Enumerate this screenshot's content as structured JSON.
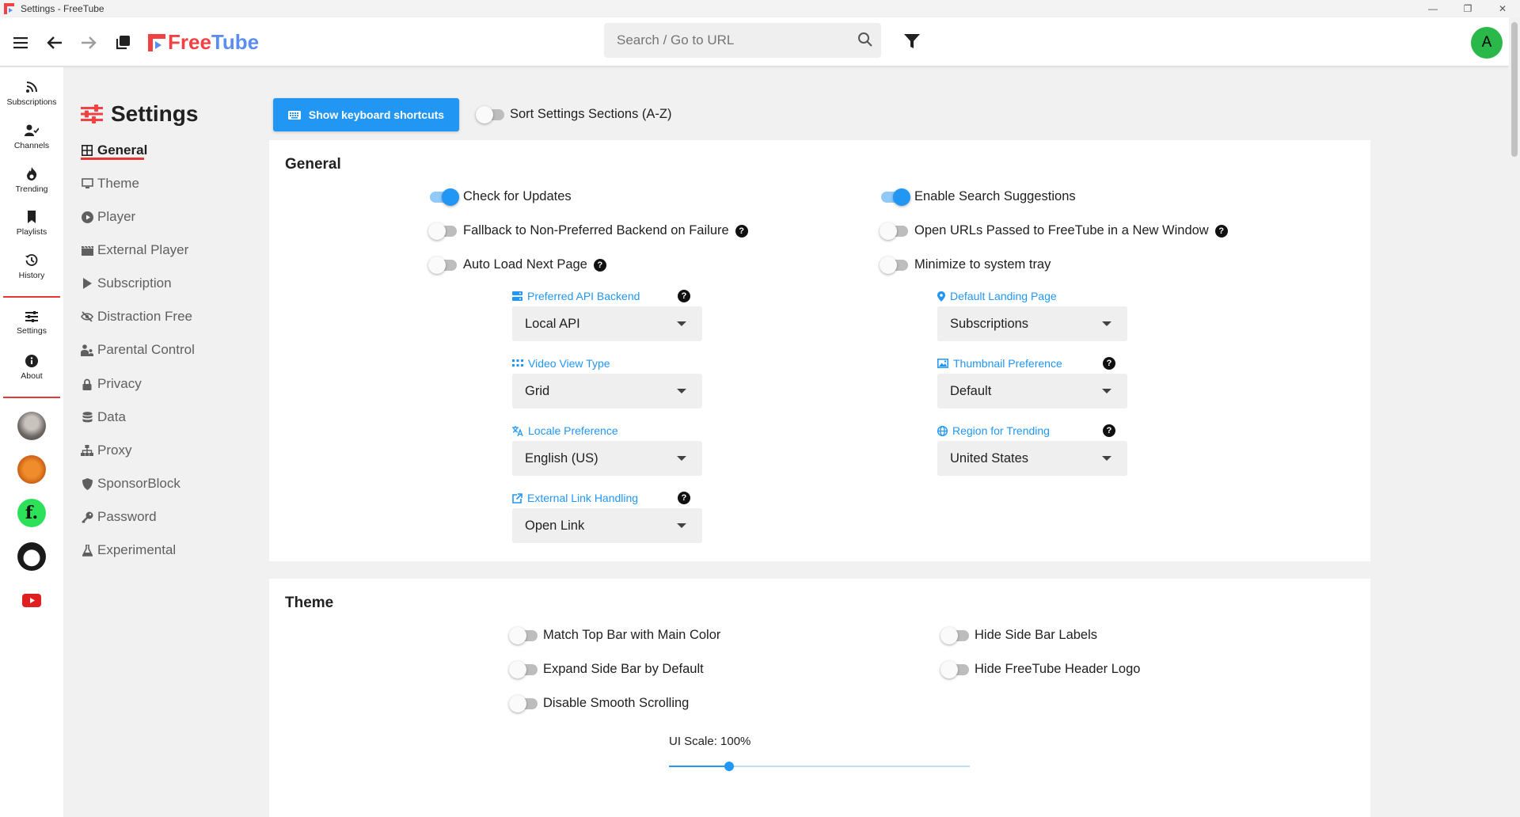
{
  "window": {
    "title": "Settings - FreeTube",
    "controls": [
      "minimize-icon",
      "restore-icon",
      "close-icon"
    ]
  },
  "topnav": {
    "logo_free": "Free",
    "logo_tube": "Tube",
    "search_placeholder": "Search / Go to URL",
    "avatar_letter": "A"
  },
  "sidebar": {
    "items": [
      {
        "label": "Subscriptions",
        "icon": "rss-icon"
      },
      {
        "label": "Channels",
        "icon": "user-check-icon"
      },
      {
        "label": "Trending",
        "icon": "fire-icon"
      },
      {
        "label": "Playlists",
        "icon": "bookmark-icon"
      },
      {
        "label": "History",
        "icon": "history-icon"
      },
      {
        "label": "Settings",
        "icon": "sliders-icon"
      },
      {
        "label": "About",
        "icon": "info-icon"
      }
    ]
  },
  "settings": {
    "title": "Settings",
    "menu": [
      {
        "label": "General",
        "icon": "grid-icon"
      },
      {
        "label": "Theme",
        "icon": "monitor-icon"
      },
      {
        "label": "Player",
        "icon": "play-circle-icon"
      },
      {
        "label": "External Player",
        "icon": "clapperboard-icon"
      },
      {
        "label": "Subscription",
        "icon": "play-icon"
      },
      {
        "label": "Distraction Free",
        "icon": "eye-slash-icon"
      },
      {
        "label": "Parental Control",
        "icon": "parent-child-icon"
      },
      {
        "label": "Privacy",
        "icon": "lock-icon"
      },
      {
        "label": "Data",
        "icon": "database-icon"
      },
      {
        "label": "Proxy",
        "icon": "network-icon"
      },
      {
        "label": "SponsorBlock",
        "icon": "shield-icon"
      },
      {
        "label": "Password",
        "icon": "key-icon"
      },
      {
        "label": "Experimental",
        "icon": "flask-icon"
      }
    ],
    "active_section": "General",
    "keyboard_button": "Show keyboard shortcuts",
    "sort_toggle": {
      "label": "Sort Settings Sections (A-Z)",
      "on": false
    }
  },
  "general": {
    "title": "General",
    "left_toggles": [
      {
        "label": "Check for Updates",
        "on": true,
        "help": false
      },
      {
        "label": "Fallback to Non-Preferred Backend on Failure",
        "on": false,
        "help": true
      },
      {
        "label": "Auto Load Next Page",
        "on": false,
        "help": true
      }
    ],
    "right_toggles": [
      {
        "label": "Enable Search Suggestions",
        "on": true,
        "help": false
      },
      {
        "label": "Open URLs Passed to FreeTube in a New Window",
        "on": false,
        "help": true
      },
      {
        "label": "Minimize to system tray",
        "on": false,
        "help": false
      }
    ],
    "left_selects": [
      {
        "label": "Preferred API Backend",
        "value": "Local API",
        "icon": "server-icon",
        "help": true
      },
      {
        "label": "Video View Type",
        "value": "Grid",
        "icon": "grid-dots-icon",
        "help": false
      },
      {
        "label": "Locale Preference",
        "value": "English (US)",
        "icon": "language-icon",
        "help": false
      },
      {
        "label": "External Link Handling",
        "value": "Open Link",
        "icon": "external-link-icon",
        "help": true
      }
    ],
    "right_selects": [
      {
        "label": "Default Landing Page",
        "value": "Subscriptions",
        "icon": "location-pin-icon",
        "help": false
      },
      {
        "label": "Thumbnail Preference",
        "value": "Default",
        "icon": "image-icon",
        "help": true
      },
      {
        "label": "Region for Trending",
        "value": "United States",
        "icon": "globe-icon",
        "help": true
      }
    ]
  },
  "theme": {
    "title": "Theme",
    "left_toggles": [
      {
        "label": "Match Top Bar with Main Color",
        "on": false
      },
      {
        "label": "Expand Side Bar by Default",
        "on": false
      },
      {
        "label": "Disable Smooth Scrolling",
        "on": false
      }
    ],
    "right_toggles": [
      {
        "label": "Hide Side Bar Labels",
        "on": false
      },
      {
        "label": "Hide FreeTube Header Logo",
        "on": false
      }
    ],
    "ui_scale_label": "UI Scale: 100%",
    "ui_scale_fraction": 0.2
  },
  "colors": {
    "accent": "#2196f3",
    "brand_red": "#f04242",
    "avatar_green": "#2bb84a"
  }
}
